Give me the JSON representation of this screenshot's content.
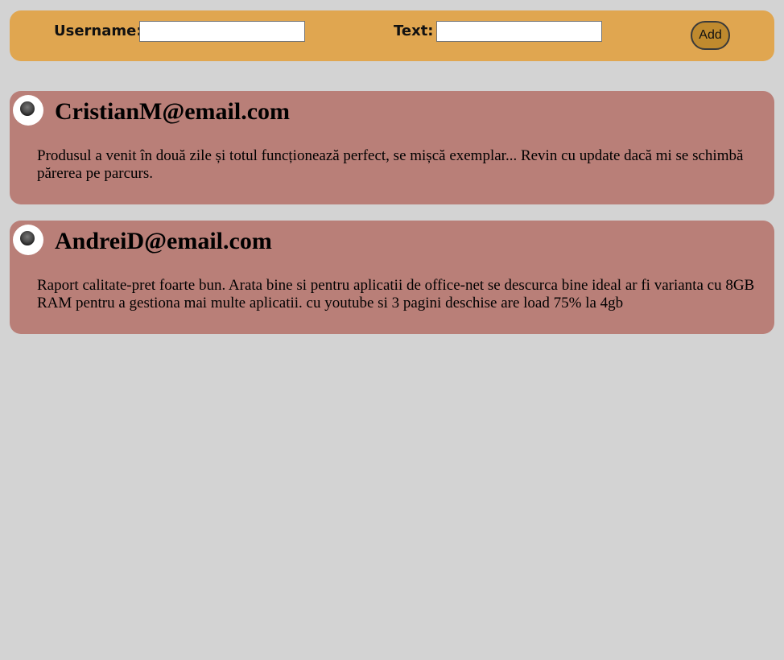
{
  "form": {
    "username_label": "Username:",
    "username_value": "",
    "text_label": "Text:",
    "text_value": "",
    "add_label": "Add"
  },
  "reviews": [
    {
      "user": "CristianM@email.com",
      "text": "Produsul a venit în două zile și totul funcționează perfect, se mișcă exemplar... Revin cu update dacă mi se schimbă părerea pe parcurs."
    },
    {
      "user": "AndreiD@email.com",
      "text": "Raport calitate-pret foarte bun. Arata bine si pentru aplicatii de office-net se descurca bine ideal ar fi varianta cu 8GB RAM pentru a gestiona mai multe aplicatii. cu youtube si 3 pagini deschise are load 75% la 4gb"
    }
  ]
}
